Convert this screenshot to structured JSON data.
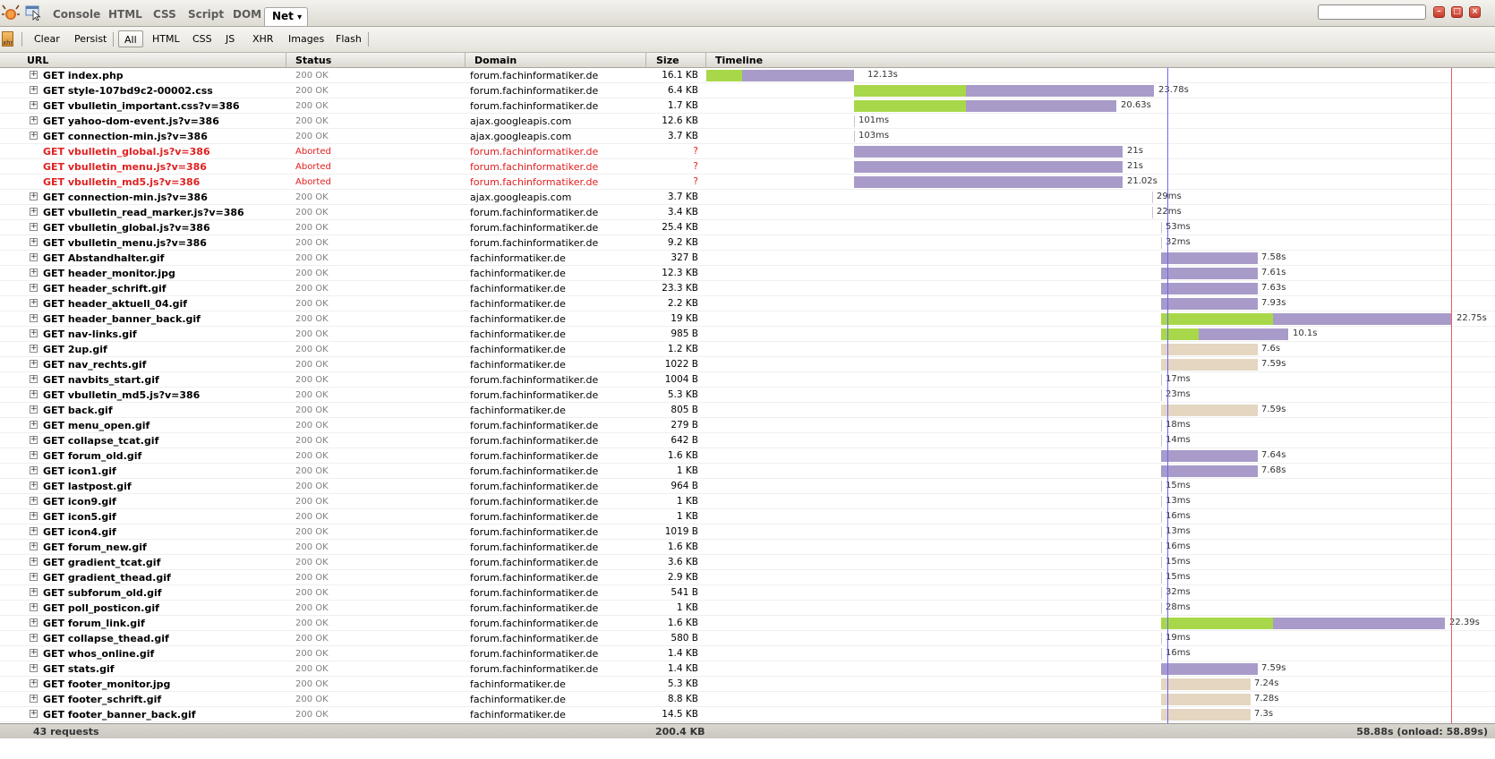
{
  "top_tabs": [
    "Console",
    "HTML",
    "CSS",
    "Script",
    "DOM",
    "Net"
  ],
  "active_tab": "Net",
  "net_dropdown": "▾",
  "toolbar": {
    "clear": "Clear",
    "persist": "Persist",
    "filters": [
      "All",
      "HTML",
      "CSS",
      "JS",
      "XHR",
      "Images",
      "Flash"
    ],
    "active_filter": "All",
    "xhr_icon": "xhr"
  },
  "columns": {
    "url": "URL",
    "status": "Status",
    "domain": "Domain",
    "size": "Size",
    "timeline": "Timeline"
  },
  "colors": {
    "green": "#a8d84a",
    "purple": "#a89bc9",
    "tan": "#e4d6c0",
    "aborted": "#e02020",
    "dom_line": "#6666ff",
    "load_line": "#e06060"
  },
  "requests": [
    {
      "url": "GET index.php",
      "status": "200 OK",
      "domain": "forum.fachinformatiker.de",
      "size": "16.1 KB",
      "time": "12.13s",
      "aborted": false
    },
    {
      "url": "GET style-107bd9c2-00002.css",
      "status": "200 OK",
      "domain": "forum.fachinformatiker.de",
      "size": "6.4 KB",
      "time": "23.78s",
      "aborted": false
    },
    {
      "url": "GET vbulletin_important.css?v=386",
      "status": "200 OK",
      "domain": "forum.fachinformatiker.de",
      "size": "1.7 KB",
      "time": "20.63s",
      "aborted": false
    },
    {
      "url": "GET yahoo-dom-event.js?v=386",
      "status": "200 OK",
      "domain": "ajax.googleapis.com",
      "size": "12.6 KB",
      "time": "101ms",
      "aborted": false
    },
    {
      "url": "GET connection-min.js?v=386",
      "status": "200 OK",
      "domain": "ajax.googleapis.com",
      "size": "3.7 KB",
      "time": "103ms",
      "aborted": false
    },
    {
      "url": "GET vbulletin_global.js?v=386",
      "status": "Aborted",
      "domain": "forum.fachinformatiker.de",
      "size": "?",
      "time": "21s",
      "aborted": true
    },
    {
      "url": "GET vbulletin_menu.js?v=386",
      "status": "Aborted",
      "domain": "forum.fachinformatiker.de",
      "size": "?",
      "time": "21s",
      "aborted": true
    },
    {
      "url": "GET vbulletin_md5.js?v=386",
      "status": "Aborted",
      "domain": "forum.fachinformatiker.de",
      "size": "?",
      "time": "21.02s",
      "aborted": true
    },
    {
      "url": "GET connection-min.js?v=386",
      "status": "200 OK",
      "domain": "ajax.googleapis.com",
      "size": "3.7 KB",
      "time": "29ms",
      "aborted": false
    },
    {
      "url": "GET vbulletin_read_marker.js?v=386",
      "status": "200 OK",
      "domain": "forum.fachinformatiker.de",
      "size": "3.4 KB",
      "time": "22ms",
      "aborted": false
    },
    {
      "url": "GET vbulletin_global.js?v=386",
      "status": "200 OK",
      "domain": "forum.fachinformatiker.de",
      "size": "25.4 KB",
      "time": "53ms",
      "aborted": false
    },
    {
      "url": "GET vbulletin_menu.js?v=386",
      "status": "200 OK",
      "domain": "forum.fachinformatiker.de",
      "size": "9.2 KB",
      "time": "32ms",
      "aborted": false
    },
    {
      "url": "GET Abstandhalter.gif",
      "status": "200 OK",
      "domain": "fachinformatiker.de",
      "size": "327 B",
      "time": "7.58s",
      "aborted": false
    },
    {
      "url": "GET header_monitor.jpg",
      "status": "200 OK",
      "domain": "fachinformatiker.de",
      "size": "12.3 KB",
      "time": "7.61s",
      "aborted": false
    },
    {
      "url": "GET header_schrift.gif",
      "status": "200 OK",
      "domain": "fachinformatiker.de",
      "size": "23.3 KB",
      "time": "7.63s",
      "aborted": false
    },
    {
      "url": "GET header_aktuell_04.gif",
      "status": "200 OK",
      "domain": "fachinformatiker.de",
      "size": "2.2 KB",
      "time": "7.93s",
      "aborted": false
    },
    {
      "url": "GET header_banner_back.gif",
      "status": "200 OK",
      "domain": "fachinformatiker.de",
      "size": "19 KB",
      "time": "22.75s",
      "aborted": false
    },
    {
      "url": "GET nav-links.gif",
      "status": "200 OK",
      "domain": "fachinformatiker.de",
      "size": "985 B",
      "time": "10.1s",
      "aborted": false
    },
    {
      "url": "GET 2up.gif",
      "status": "200 OK",
      "domain": "fachinformatiker.de",
      "size": "1.2 KB",
      "time": "7.6s",
      "aborted": false
    },
    {
      "url": "GET nav_rechts.gif",
      "status": "200 OK",
      "domain": "fachinformatiker.de",
      "size": "1022 B",
      "time": "7.59s",
      "aborted": false
    },
    {
      "url": "GET navbits_start.gif",
      "status": "200 OK",
      "domain": "forum.fachinformatiker.de",
      "size": "1004 B",
      "time": "17ms",
      "aborted": false
    },
    {
      "url": "GET vbulletin_md5.js?v=386",
      "status": "200 OK",
      "domain": "forum.fachinformatiker.de",
      "size": "5.3 KB",
      "time": "23ms",
      "aborted": false
    },
    {
      "url": "GET back.gif",
      "status": "200 OK",
      "domain": "fachinformatiker.de",
      "size": "805 B",
      "time": "7.59s",
      "aborted": false
    },
    {
      "url": "GET menu_open.gif",
      "status": "200 OK",
      "domain": "forum.fachinformatiker.de",
      "size": "279 B",
      "time": "18ms",
      "aborted": false
    },
    {
      "url": "GET collapse_tcat.gif",
      "status": "200 OK",
      "domain": "forum.fachinformatiker.de",
      "size": "642 B",
      "time": "14ms",
      "aborted": false
    },
    {
      "url": "GET forum_old.gif",
      "status": "200 OK",
      "domain": "forum.fachinformatiker.de",
      "size": "1.6 KB",
      "time": "7.64s",
      "aborted": false
    },
    {
      "url": "GET icon1.gif",
      "status": "200 OK",
      "domain": "forum.fachinformatiker.de",
      "size": "1 KB",
      "time": "7.68s",
      "aborted": false
    },
    {
      "url": "GET lastpost.gif",
      "status": "200 OK",
      "domain": "forum.fachinformatiker.de",
      "size": "964 B",
      "time": "15ms",
      "aborted": false
    },
    {
      "url": "GET icon9.gif",
      "status": "200 OK",
      "domain": "forum.fachinformatiker.de",
      "size": "1 KB",
      "time": "13ms",
      "aborted": false
    },
    {
      "url": "GET icon5.gif",
      "status": "200 OK",
      "domain": "forum.fachinformatiker.de",
      "size": "1 KB",
      "time": "16ms",
      "aborted": false
    },
    {
      "url": "GET icon4.gif",
      "status": "200 OK",
      "domain": "forum.fachinformatiker.de",
      "size": "1019 B",
      "time": "13ms",
      "aborted": false
    },
    {
      "url": "GET forum_new.gif",
      "status": "200 OK",
      "domain": "forum.fachinformatiker.de",
      "size": "1.6 KB",
      "time": "16ms",
      "aborted": false
    },
    {
      "url": "GET gradient_tcat.gif",
      "status": "200 OK",
      "domain": "forum.fachinformatiker.de",
      "size": "3.6 KB",
      "time": "15ms",
      "aborted": false
    },
    {
      "url": "GET gradient_thead.gif",
      "status": "200 OK",
      "domain": "forum.fachinformatiker.de",
      "size": "2.9 KB",
      "time": "15ms",
      "aborted": false
    },
    {
      "url": "GET subforum_old.gif",
      "status": "200 OK",
      "domain": "forum.fachinformatiker.de",
      "size": "541 B",
      "time": "32ms",
      "aborted": false
    },
    {
      "url": "GET poll_posticon.gif",
      "status": "200 OK",
      "domain": "forum.fachinformatiker.de",
      "size": "1 KB",
      "time": "28ms",
      "aborted": false
    },
    {
      "url": "GET forum_link.gif",
      "status": "200 OK",
      "domain": "forum.fachinformatiker.de",
      "size": "1.6 KB",
      "time": "22.39s",
      "aborted": false
    },
    {
      "url": "GET collapse_thead.gif",
      "status": "200 OK",
      "domain": "forum.fachinformatiker.de",
      "size": "580 B",
      "time": "19ms",
      "aborted": false
    },
    {
      "url": "GET whos_online.gif",
      "status": "200 OK",
      "domain": "forum.fachinformatiker.de",
      "size": "1.4 KB",
      "time": "16ms",
      "aborted": false
    },
    {
      "url": "GET stats.gif",
      "status": "200 OK",
      "domain": "forum.fachinformatiker.de",
      "size": "1.4 KB",
      "time": "7.59s",
      "aborted": false
    },
    {
      "url": "GET footer_monitor.jpg",
      "status": "200 OK",
      "domain": "fachinformatiker.de",
      "size": "5.3 KB",
      "time": "7.24s",
      "aborted": false
    },
    {
      "url": "GET footer_schrift.gif",
      "status": "200 OK",
      "domain": "fachinformatiker.de",
      "size": "8.8 KB",
      "time": "7.28s",
      "aborted": false
    },
    {
      "url": "GET footer_banner_back.gif",
      "status": "200 OK",
      "domain": "fachinformatiker.de",
      "size": "14.5 KB",
      "time": "7.3s",
      "aborted": false
    }
  ],
  "footer": {
    "requests": "43 requests",
    "total_size": "200.4 KB",
    "total_time": "58.88s (onload: 58.89s)"
  }
}
